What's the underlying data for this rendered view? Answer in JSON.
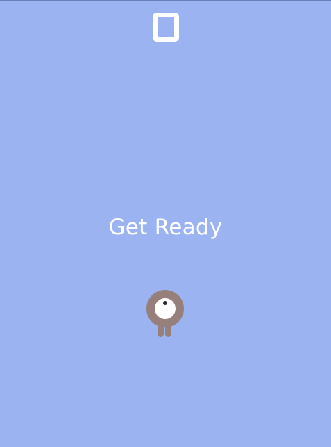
{
  "game": {
    "score": "0",
    "message": "Get Ready",
    "background_color": "#9bb4f1",
    "text_color": "#ffffff"
  },
  "player": {
    "icon": "one-eyed-creature-icon",
    "body_color": "#977f7b",
    "eye_color": "#ffffff",
    "pupil_color": "#2d2d2d"
  }
}
